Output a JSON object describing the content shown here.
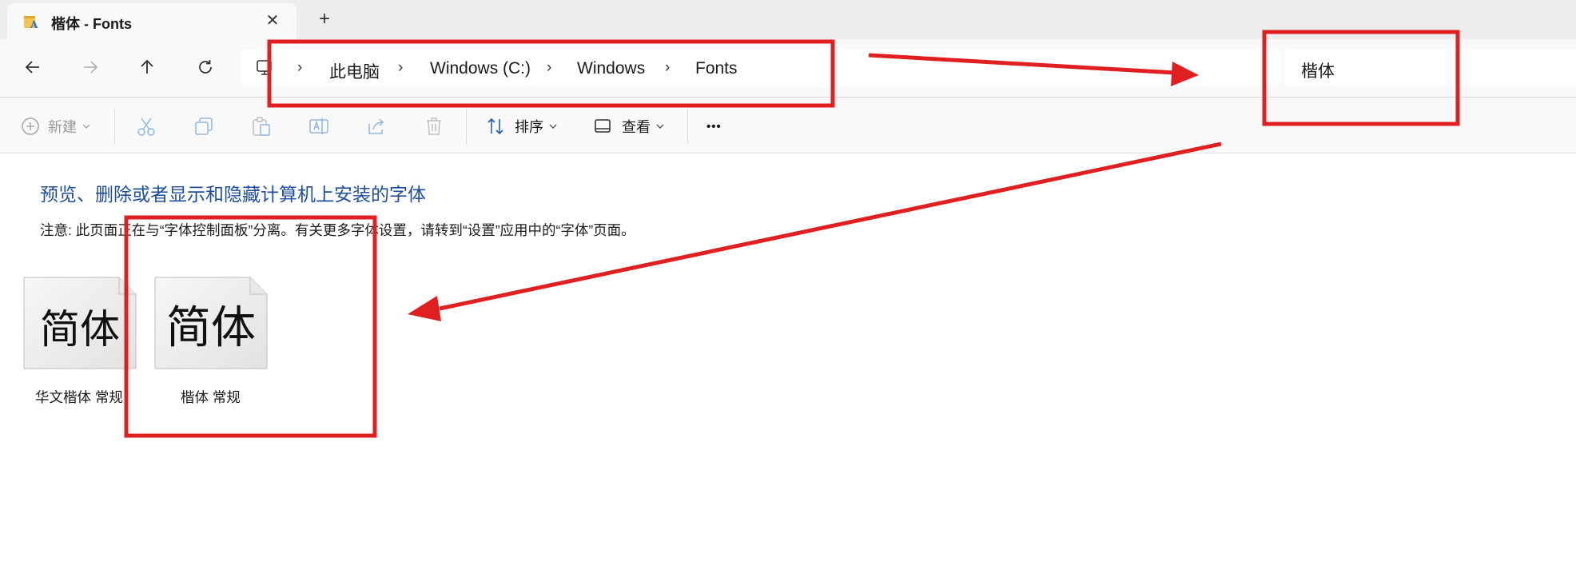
{
  "window": {
    "tab_title": "楷体 - Fonts",
    "close_glyph": "✕",
    "new_tab_glyph": "+"
  },
  "navigation": {
    "breadcrumbs": [
      "此电脑",
      "Windows (C:)",
      "Windows",
      "Fonts"
    ],
    "separator": "›",
    "search_value": "楷体"
  },
  "toolbar": {
    "new_label": "新建",
    "sort_label": "排序",
    "view_label": "查看",
    "more_glyph": "•••"
  },
  "content": {
    "heading": "预览、删除或者显示和隐藏计算机上安装的字体",
    "note": "注意: 此页面正在与“字体控制面板”分离。有关更多字体设置，请转到“设置”应用中的“字体”页面。",
    "fonts": [
      {
        "preview_text": "简体",
        "name": "华文楷体 常规"
      },
      {
        "preview_text": "简体",
        "name": "楷体 常规"
      }
    ]
  },
  "annotation": {
    "color": "#e02020"
  }
}
